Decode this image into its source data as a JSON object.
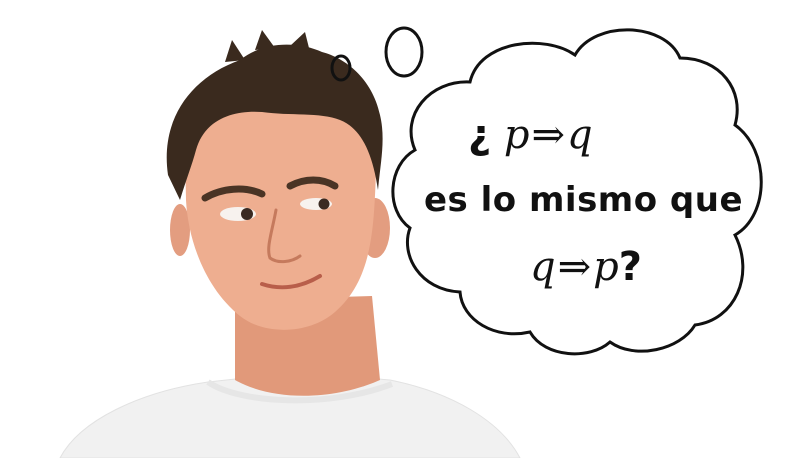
{
  "thought_bubble": {
    "line1": {
      "open_q": "¿",
      "p": "p",
      "arrow": "⇒",
      "q": "q"
    },
    "line2": "es lo mismo que",
    "line3": {
      "q": "q",
      "arrow": "⇒",
      "p": "p",
      "close_q": "?"
    }
  },
  "colors": {
    "background": "#ffffff",
    "ink": "#111111",
    "skin": "#e9a98a",
    "hair": "#3a2a1e",
    "shirt": "#f3f3f3"
  }
}
